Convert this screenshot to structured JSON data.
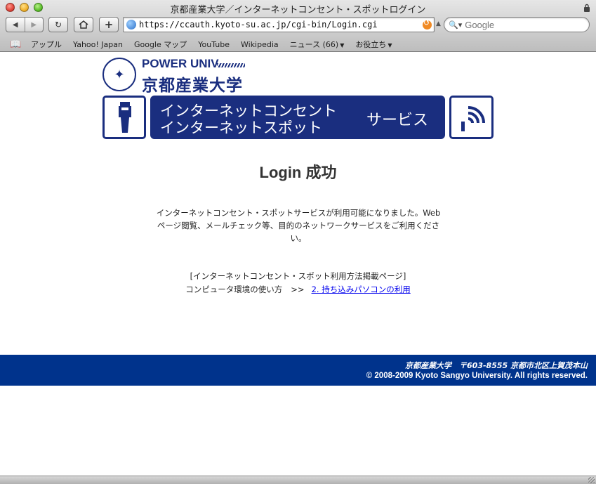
{
  "window": {
    "title": "京都産業大学／インターネットコンセント・スポットログイン"
  },
  "toolbar": {
    "back_icon": "back-arrow-icon",
    "forward_icon": "forward-arrow-icon",
    "reload_icon": "reload-icon",
    "home_icon": "home-icon",
    "add_icon": "plus-icon",
    "add_label": "+",
    "url": "https://ccauth.kyoto-su.ac.jp/cgi-bin/Login.cgi",
    "search_placeholder": "Google"
  },
  "bookmarks": [
    "アップル",
    "Yahoo! Japan",
    "Google マップ",
    "YouTube",
    "Wikipedia",
    "ニュース (66)",
    "お役立ち"
  ],
  "header": {
    "power_label": "POWER UNIV.",
    "university_name": "京都産業大学",
    "banner_line1": "インターネットコンセント",
    "banner_line2": "インターネットスポット",
    "banner_service": "サービス"
  },
  "main": {
    "login_title": "Login 成功",
    "message": "インターネットコンセント・スポットサービスが利用可能になりました。Webページ閲覧、メールチェック等、目的のネットワークサービスをご利用ください。",
    "usage_heading": "[インターネットコンセント・スポット利用方法掲載ページ]",
    "usage_label": "コンピュータ環境の使い方",
    "usage_arrow": ">>",
    "usage_link": "2. 持ち込みパソコンの利用"
  },
  "footer": {
    "address": "京都産業大学　〒603-8555 京都市北区上賀茂本山",
    "copyright": "© 2008-2009 Kyoto Sangyo University. All rights reserved."
  },
  "colors": {
    "brand_blue": "#1a2e7f",
    "footer_blue": "#00338c",
    "link": "#0000ee"
  }
}
